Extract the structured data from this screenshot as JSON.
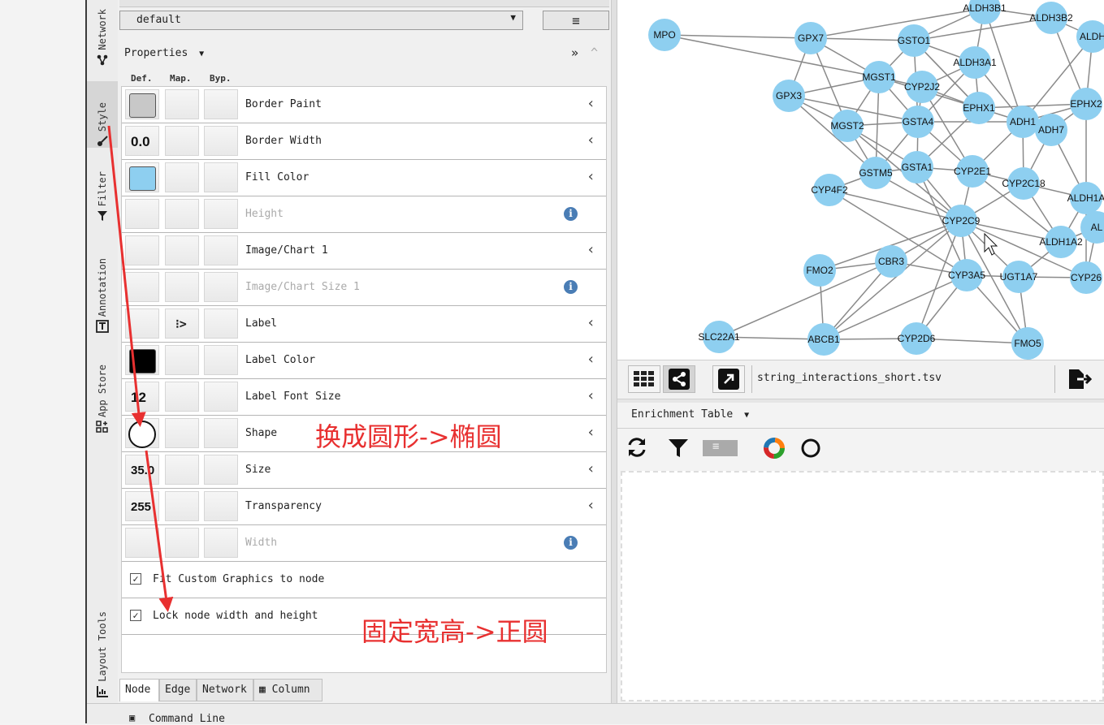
{
  "vertical_tabs": [
    {
      "label": "Network",
      "icon": "network-icon"
    },
    {
      "label": "Style",
      "icon": "brush-icon"
    },
    {
      "label": "Filter",
      "icon": "filter-icon"
    },
    {
      "label": "Annotation",
      "icon": "annotation-icon"
    },
    {
      "label": "App Store",
      "icon": "app-store-icon"
    },
    {
      "label": "Layout Tools",
      "icon": "layout-tools-icon"
    }
  ],
  "style_select": {
    "value": "default"
  },
  "properties": {
    "title": "Properties",
    "columns": {
      "def": "Def.",
      "map": "Map.",
      "byp": "Byp."
    },
    "rows": [
      {
        "name": "Border Paint",
        "def_color": "#c8c8c8",
        "disabled": false
      },
      {
        "name": "Border Width",
        "def_value": "0.0",
        "disabled": false
      },
      {
        "name": "Fill Color",
        "def_color": "#8ecff0",
        "disabled": false
      },
      {
        "name": "Height",
        "disabled": true
      },
      {
        "name": "Image/Chart 1",
        "disabled": false
      },
      {
        "name": "Image/Chart Size 1",
        "disabled": true
      },
      {
        "name": "Label",
        "disabled": false,
        "map_icon": "passthrough-mapping-icon"
      },
      {
        "name": "Label Color",
        "def_color": "#000000",
        "disabled": false
      },
      {
        "name": "Label Font Size",
        "def_value": "12",
        "disabled": false
      },
      {
        "name": "Shape",
        "def_shape": "circle",
        "disabled": false
      },
      {
        "name": "Size",
        "def_value": "35.0",
        "disabled": false
      },
      {
        "name": "Transparency",
        "def_value": "255",
        "disabled": false
      },
      {
        "name": "Width",
        "disabled": true
      }
    ],
    "checkboxes": [
      {
        "label": "Fit Custom Graphics to node",
        "checked": true
      },
      {
        "label": "Lock node width and height",
        "checked": true
      }
    ]
  },
  "bottom_tabs": [
    "Node",
    "Edge",
    "Network",
    "Column"
  ],
  "command_line": "Command Line",
  "network": {
    "file": "string_interactions_short.tsv",
    "nodes": [
      {
        "label": "MPO"
      },
      {
        "label": "GPX7"
      },
      {
        "label": "GSTO1"
      },
      {
        "label": "ALDH3B1"
      },
      {
        "label": "ALDH3B2"
      },
      {
        "label": "ALDH"
      },
      {
        "label": "GPX3"
      },
      {
        "label": "MGST1"
      },
      {
        "label": "CYP2J2"
      },
      {
        "label": "ALDH3A1"
      },
      {
        "label": "EPHX1"
      },
      {
        "label": "EPHX2"
      },
      {
        "label": "MGST2"
      },
      {
        "label": "GSTA4"
      },
      {
        "label": "ADH1"
      },
      {
        "label": "ADH7"
      },
      {
        "label": "GSTM5"
      },
      {
        "label": "GSTA1"
      },
      {
        "label": "CYP2E1"
      },
      {
        "label": "CYP2C18"
      },
      {
        "label": "ALDH1A"
      },
      {
        "label": "CYP4F2"
      },
      {
        "label": "CYP2C9"
      },
      {
        "label": "ALDH1A2"
      },
      {
        "label": "AL"
      },
      {
        "label": "FMO2"
      },
      {
        "label": "CBR3"
      },
      {
        "label": "CYP3A5"
      },
      {
        "label": "UGT1A7"
      },
      {
        "label": "CYP26"
      },
      {
        "label": "SLC22A1"
      },
      {
        "label": "ABCB1"
      },
      {
        "label": "CYP2D6"
      },
      {
        "label": "FMO5"
      }
    ],
    "node_color": "#8ecff0",
    "edge_color": "#8a8a8a"
  },
  "enrichment": {
    "title": "Enrichment Table"
  },
  "annotations": [
    {
      "text": "换成圆形->椭圆"
    },
    {
      "text": "固定宽高->正圆"
    }
  ],
  "annotation_color": "#e83030"
}
